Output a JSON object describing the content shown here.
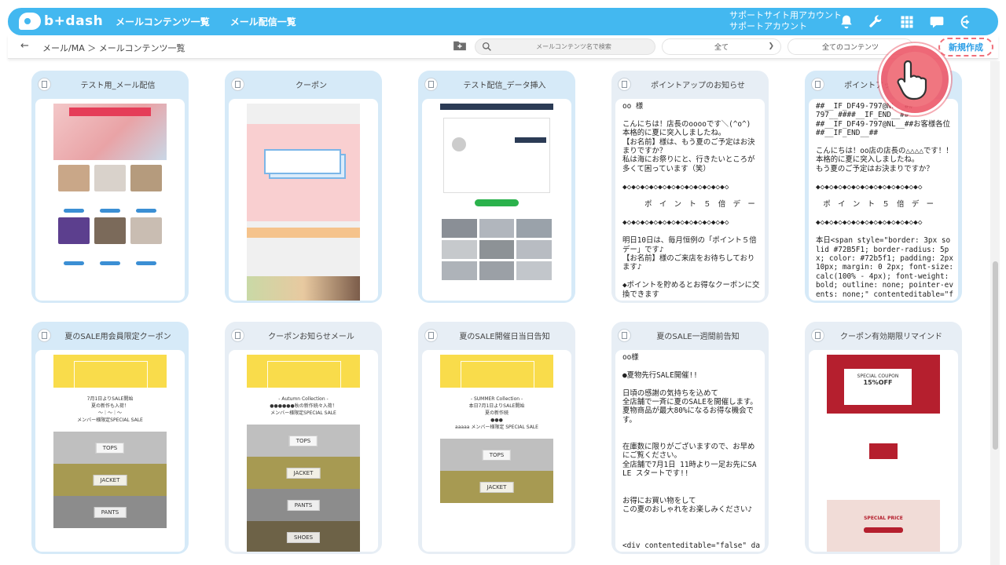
{
  "header": {
    "logo_text": "b+dash",
    "nav": [
      "メールコンテンツ一覧",
      "メール配信一覧"
    ],
    "account_line1": "サポートサイト用アカウント",
    "account_line2": "サポートアカウント",
    "icons": [
      "bell-icon",
      "wrench-icon",
      "grid-icon",
      "chat-icon",
      "logout-icon"
    ],
    "color": "#43b8f0"
  },
  "subbar": {
    "back": "←",
    "breadcrumb": "メール/MA ＞ メールコンテンツ一覧",
    "search_placeholder": "メールコンテンツ名で検索",
    "filter1": "全て",
    "filter2": "全てのコンテンツ",
    "new_button": "新規作成"
  },
  "cards": [
    {
      "title": "テスト用_メール配信",
      "style": "blue",
      "kind": "job"
    },
    {
      "title": "クーポン",
      "style": "blue",
      "kind": "coupon"
    },
    {
      "title": "テスト配信_データ挿入",
      "style": "blue",
      "kind": "data"
    },
    {
      "title": "ポイントアップのお知らせ",
      "style": "gray",
      "kind": "text",
      "text": "oo 様\n\nこんにちは！店長のooooです＼(^o^)\n本格的に夏に突入しましたね。\n【お名前】様は、もう夏のご予定はお決まりですか？\n私は海にお祭りにと、行きたいところが多くて困っています（笑）\n\n◆◇◆◇◆◇◆◇◆◇◆◇◆◇◆◇◆◇◆◇◆◇◆◇\n\n　　　ポ　イ　ン　ト　５　倍　デ　ー\n\n◆◇◆◇◆◇◆◇◆◇◆◇◆◇◆◇◆◇◆◇◆◇◆◇\n\n明日10日は、毎月恒例の「ポイント５倍デー」です♪\n【お名前】様のご来店をお待ちしております♪\n\n◆ポイントを貯めるとお得なクーポンに交換できます"
    },
    {
      "title": "ポイントアップのお知らせ",
      "style": "blue",
      "kind": "text",
      "text": "##__IF_DF49-797@NL__##\n797__####__IF_END__##\n##__IF_DF49-797@NL__##お客様各位\n##__IF_END__##\n\nこんにちは！oo店の店長の△△△△です！！\n本格的に夏に突入しましたね。\nもう夏のご予定はお決まりですか？\n\n◆◇◆◇◆◇◆◇◆◇◆◇◆◇◆◇◆◇◆◇◆◇◆◇\n\n　ポ　イ　ン　ト　５　倍　デ　ー\n\n◆◇◆◇◆◇◆◇◆◇◆◇◆◇◆◇◆◇◆◇◆◇◆◇\n\n本日<span style=\"border: 3px solid #72B5F1; border-radius: 5px; color: #72b5f1; padding: 2px 10px; margin: 0 2px; font-size: calc(100% - 4px); font-weight: bold; outline: none; pointer-events: none;\" contenteditable=\"false\" data-insertion=\"##__DATE:"
    },
    {
      "title": "夏のSALE用会員限定クーポン",
      "style": "blue",
      "kind": "sale",
      "lines": [
        "7月1日よりSALE開始",
        "夏の新作も入荷！",
        "〜｜〜｜〜",
        "メンバー様限定SPECIAL SALE"
      ],
      "cats": [
        "TOPS",
        "JACKET",
        "PANTS"
      ]
    },
    {
      "title": "クーポンお知らせメール",
      "style": "gray",
      "kind": "sale",
      "lines": [
        "- Autumn Collection -",
        "●●●●●●秋の新作続々入荷！",
        "メンバー様限定SPECIAL SALE"
      ],
      "cats": [
        "TOPS",
        "JACKET",
        "PANTS",
        "SHOES"
      ]
    },
    {
      "title": "夏のSALE開催日当日告知",
      "style": "gray",
      "kind": "sale",
      "lines": [
        "- SUMMER Collection -",
        "本日7月1日よりSALE開始",
        "夏の新作続",
        "●●●",
        "aaaaa メンバー様限定 SPECIAL SALE"
      ],
      "cats": [
        "TOPS",
        "JACKET"
      ]
    },
    {
      "title": "夏のSALE一週間前告知",
      "style": "gray",
      "kind": "text",
      "text": "oo様\n\n●夏物先行SALE開催!!\n\n日頃の感謝の気持ちを込めて\n全店舗で一斉に夏のSALEを開催します。\n夏物商品が最大80%になるお得な機会です。\n\n\n在庫数に限りがございますので、お早めにご覧ください。\n全店舗で7月1日 11時より一足お先にSALE スタートです!!\n\n\nお得にお買い物をして\nこの夏のおしゃれをお楽しみください♪\n\n\n\n<div contenteditable=\"false\" data-insertion=\"##__CBX_PLAINTEXT:34__##\">oo株式会社"
    },
    {
      "title": "クーポン有効期限リマインド",
      "style": "gray",
      "kind": "expiry",
      "coupon": "SPECIAL COUPON",
      "off": "15%OFF",
      "special": "SPECIAL PRICE"
    }
  ]
}
